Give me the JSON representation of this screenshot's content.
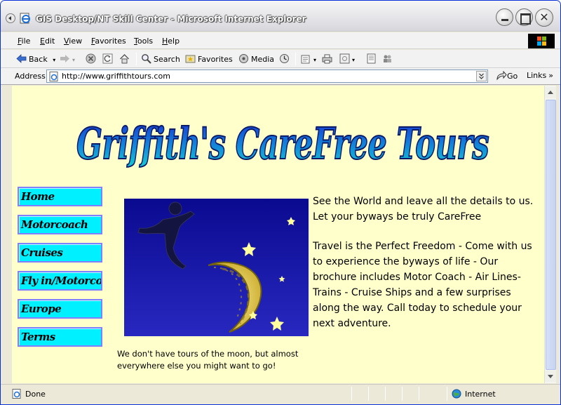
{
  "window": {
    "title": "GIS Desktop/NT Skill Center - Microsoft Internet Explorer"
  },
  "menu": {
    "items": [
      "File",
      "Edit",
      "View",
      "Favorites",
      "Tools",
      "Help"
    ]
  },
  "toolbar": {
    "back_label": "Back",
    "search_label": "Search",
    "favorites_label": "Favorites",
    "media_label": "Media"
  },
  "address_bar": {
    "label": "Address",
    "url": "http://www.griffithtours.com",
    "go_label": "Go",
    "links_label": "Links"
  },
  "page": {
    "logo_text": "Griffith's CareFree Tours",
    "nav": [
      "Home",
      "Motorcoach",
      "Cruises",
      "Fly in/Motorcoach",
      "Europe",
      "Terms"
    ],
    "caption": "We don't have tours of the moon, but almost everywhere else you might want to go!",
    "intro": "See the World and leave all the details to us. Let your byways be truly CareFree",
    "body": "Travel is the Perfect Freedom - Come with us to experience the byways of life - Our brochure includes Motor Coach - Air Lines-Trains - Cruise Ships and a few surprises along the way. Call today to schedule your next adventure."
  },
  "status_bar": {
    "status": "Done",
    "zone": "Internet"
  },
  "colors": {
    "page_background": "#ffffcc",
    "nav_button": "#00f0ff",
    "nav_border": "#8080ff",
    "logo_top": "#1a2fd0",
    "logo_bottom": "#18d0d0",
    "night_sky": "#1a1aa0",
    "moon": "#e8d040"
  },
  "icons": [
    "ie-icon",
    "back-arrow-icon",
    "forward-arrow-icon",
    "stop-icon",
    "refresh-icon",
    "home-icon",
    "search-icon",
    "favorites-icon",
    "media-icon",
    "history-icon",
    "mail-icon",
    "print-icon",
    "edit-icon",
    "discuss-icon",
    "messenger-icon",
    "page-icon",
    "go-arrow-icon",
    "globe-icon"
  ]
}
